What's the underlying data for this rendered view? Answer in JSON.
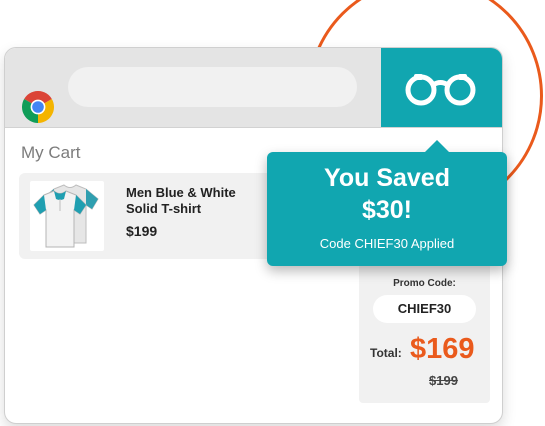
{
  "colors": {
    "accent": "#11a6b0",
    "highlight": "#ea5a1c",
    "panel": "#f1f1f1"
  },
  "browser": {
    "logo_icon": "chrome-icon",
    "extension_icon": "binoculars-icon"
  },
  "cart": {
    "title": "My Cart",
    "item": {
      "name": "Men Blue & White Solid T-shirt",
      "price": "$199"
    }
  },
  "summary": {
    "promo_label": "Promo Code:",
    "promo_code": "CHIEF30",
    "total_label": "Total:",
    "total_value": "$169",
    "original_price": "$199"
  },
  "popup": {
    "headline": "You Saved $30!",
    "subtext": "Code CHIEF30 Applied"
  }
}
